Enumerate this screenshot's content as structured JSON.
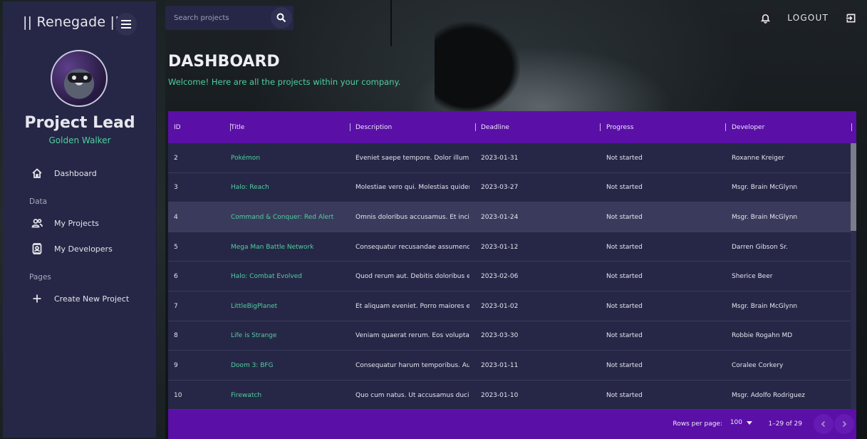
{
  "brand": "|| Renegade ||",
  "sidebar": {
    "role": "Project Lead",
    "username": "Golden Walker",
    "items": [
      {
        "label": "Dashboard",
        "icon": "home-icon"
      },
      {
        "section": "Data"
      },
      {
        "label": "My Projects",
        "icon": "people-icon"
      },
      {
        "label": "My Developers",
        "icon": "contacts-icon"
      },
      {
        "section": "Pages"
      },
      {
        "label": "Create New Project",
        "icon": "plus-icon"
      }
    ]
  },
  "search": {
    "placeholder": "Search projects"
  },
  "topbar": {
    "logout_label": "LOGOUT"
  },
  "header": {
    "title": "DASHBOARD",
    "subtitle": "Welcome! Here are all the projects within your company."
  },
  "table": {
    "columns": [
      "ID",
      "Title",
      "Description",
      "Deadline",
      "Progress",
      "Developer"
    ],
    "rows": [
      [
        "2",
        "Pokémon",
        "Eveniet saepe tempore. Dolor illum a...",
        "2023-01-31",
        "Not started",
        "Roxanne Kreiger"
      ],
      [
        "3",
        "Halo: Reach",
        "Molestiae vero qui. Molestias quidem ...",
        "2023-03-27",
        "Not started",
        "Msgr. Brain McGlynn"
      ],
      [
        "4",
        "Command & Conquer: Red Alert",
        "Omnis doloribus accusamus. Et incid...",
        "2023-01-24",
        "Not started",
        "Msgr. Brain McGlynn"
      ],
      [
        "5",
        "Mega Man Battle Network",
        "Consequatur recusandae assumenda...",
        "2023-01-12",
        "Not started",
        "Darren Gibson Sr."
      ],
      [
        "6",
        "Halo: Combat Evolved",
        "Quod rerum aut. Debitis doloribus et....",
        "2023-02-06",
        "Not started",
        "Sherice Beer"
      ],
      [
        "7",
        "LittleBigPlanet",
        "Et aliquam eveniet. Porro maiores eu...",
        "2023-01-02",
        "Not started",
        "Msgr. Brain McGlynn"
      ],
      [
        "8",
        "Life is Strange",
        "Veniam quaerat rerum. Eos voluptatu...",
        "2023-03-30",
        "Not started",
        "Robbie Rogahn MD"
      ],
      [
        "9",
        "Doom 3: BFG",
        "Consequatur harum temporibus. Aut ...",
        "2023-01-11",
        "Not started",
        "Coralee Corkery"
      ],
      [
        "10",
        "Firewatch",
        "Quo cum natus. Ut accusamus ducim...",
        "2023-01-10",
        "Not started",
        "Msgr. Adolfo Rodriguez"
      ]
    ],
    "highlighted_row_index": 2,
    "footer": {
      "rows_per_page_label": "Rows per page:",
      "rows_per_page_value": "100",
      "range_text": "1–29 of 29"
    }
  },
  "colors": {
    "sidebar_bg": "#262746",
    "accent_purple": "#5a0fa7",
    "accent_green": "#4fcf9f"
  }
}
